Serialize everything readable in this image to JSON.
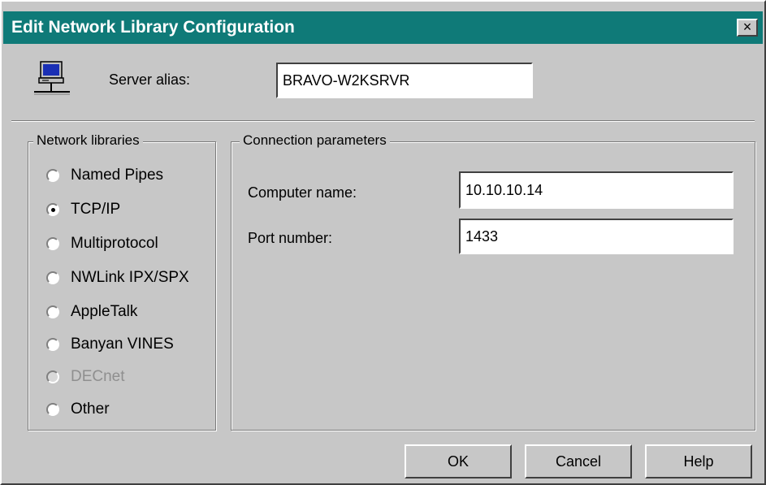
{
  "window": {
    "title": "Edit Network Library Configuration",
    "close_label": "×"
  },
  "server": {
    "alias_label": "Server alias:",
    "alias_value": "BRAVO-W2KSRVR",
    "icon": "computer-network-icon"
  },
  "network_libraries": {
    "legend": "Network libraries",
    "options": [
      {
        "label": "Named Pipes",
        "checked": false,
        "enabled": true
      },
      {
        "label": "TCP/IP",
        "checked": true,
        "enabled": true
      },
      {
        "label": "Multiprotocol",
        "checked": false,
        "enabled": true
      },
      {
        "label": "NWLink IPX/SPX",
        "checked": false,
        "enabled": true
      },
      {
        "label": "AppleTalk",
        "checked": false,
        "enabled": true
      },
      {
        "label": "Banyan VINES",
        "checked": false,
        "enabled": true
      },
      {
        "label": "DECnet",
        "checked": false,
        "enabled": false
      },
      {
        "label": "Other",
        "checked": false,
        "enabled": true
      }
    ]
  },
  "connection": {
    "legend": "Connection parameters",
    "computer_name_label": "Computer name:",
    "computer_name_value": "10.10.10.14",
    "port_label": "Port number:",
    "port_value": "1433"
  },
  "buttons": {
    "ok": "OK",
    "cancel": "Cancel",
    "help": "Help"
  },
  "colors": {
    "titlebar": "#0f7a78",
    "face": "#c7c7c7"
  }
}
